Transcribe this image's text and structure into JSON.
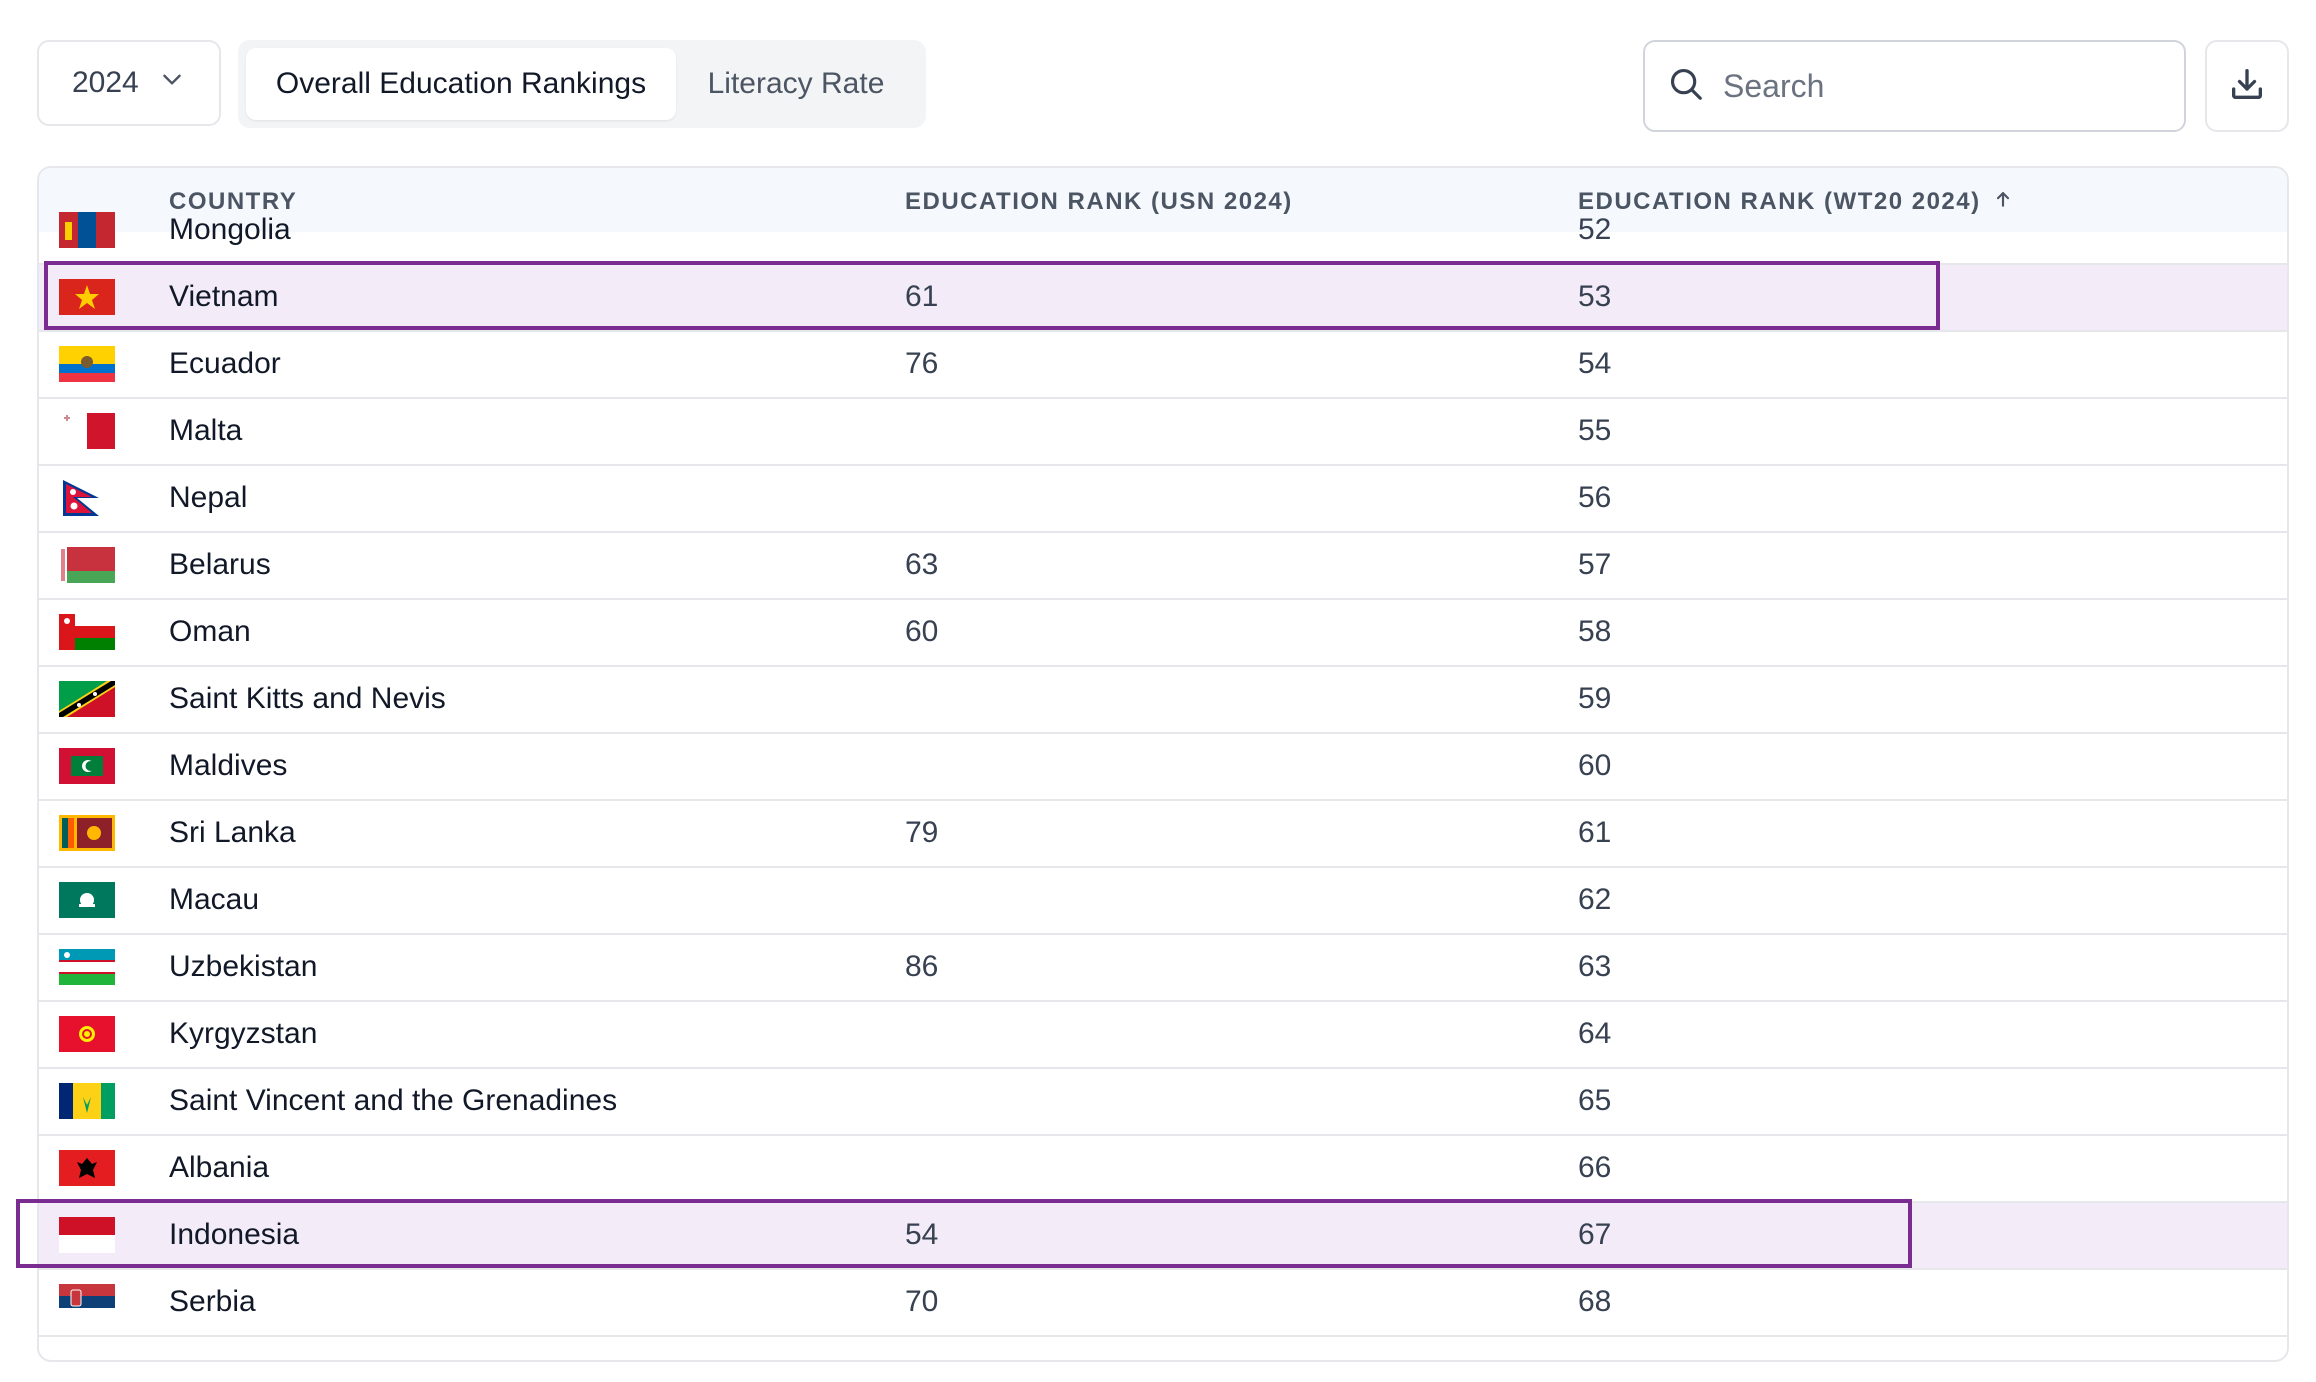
{
  "toolbar": {
    "year": "2024",
    "tabs": [
      {
        "label": "Overall Education Rankings",
        "active": true
      },
      {
        "label": "Literacy Rate",
        "active": false
      }
    ],
    "search_placeholder": "Search",
    "download_icon": "download-icon"
  },
  "table": {
    "columns": {
      "country": "COUNTRY",
      "usn": "EDUCATION RANK (USN 2024)",
      "wt20": "EDUCATION RANK (WT20 2024)"
    },
    "sort_icon": "arrow-up-icon",
    "rows": [
      {
        "country": "Mongolia",
        "usn": "",
        "wt20": "52",
        "flag": "mongolia",
        "highlight": false
      },
      {
        "country": "Vietnam",
        "usn": "61",
        "wt20": "53",
        "flag": "vietnam",
        "highlight": true
      },
      {
        "country": "Ecuador",
        "usn": "76",
        "wt20": "54",
        "flag": "ecuador",
        "highlight": false
      },
      {
        "country": "Malta",
        "usn": "",
        "wt20": "55",
        "flag": "malta",
        "highlight": false
      },
      {
        "country": "Nepal",
        "usn": "",
        "wt20": "56",
        "flag": "nepal",
        "highlight": false
      },
      {
        "country": "Belarus",
        "usn": "63",
        "wt20": "57",
        "flag": "belarus",
        "highlight": false
      },
      {
        "country": "Oman",
        "usn": "60",
        "wt20": "58",
        "flag": "oman",
        "highlight": false
      },
      {
        "country": "Saint Kitts and Nevis",
        "usn": "",
        "wt20": "59",
        "flag": "saint-kitts",
        "highlight": false
      },
      {
        "country": "Maldives",
        "usn": "",
        "wt20": "60",
        "flag": "maldives",
        "highlight": false
      },
      {
        "country": "Sri Lanka",
        "usn": "79",
        "wt20": "61",
        "flag": "sri-lanka",
        "highlight": false
      },
      {
        "country": "Macau",
        "usn": "",
        "wt20": "62",
        "flag": "macau",
        "highlight": false
      },
      {
        "country": "Uzbekistan",
        "usn": "86",
        "wt20": "63",
        "flag": "uzbekistan",
        "highlight": false
      },
      {
        "country": "Kyrgyzstan",
        "usn": "",
        "wt20": "64",
        "flag": "kyrgyzstan",
        "highlight": false
      },
      {
        "country": "Saint Vincent and the Grenadines",
        "usn": "",
        "wt20": "65",
        "flag": "saint-vincent",
        "highlight": false
      },
      {
        "country": "Albania",
        "usn": "",
        "wt20": "66",
        "flag": "albania",
        "highlight": false
      },
      {
        "country": "Indonesia",
        "usn": "54",
        "wt20": "67",
        "flag": "indonesia",
        "highlight": true
      },
      {
        "country": "Serbia",
        "usn": "70",
        "wt20": "68",
        "flag": "serbia",
        "highlight": false
      }
    ]
  },
  "colors": {
    "highlight_border": "#7b2c91",
    "highlight_fill": "#f3ecf8"
  }
}
